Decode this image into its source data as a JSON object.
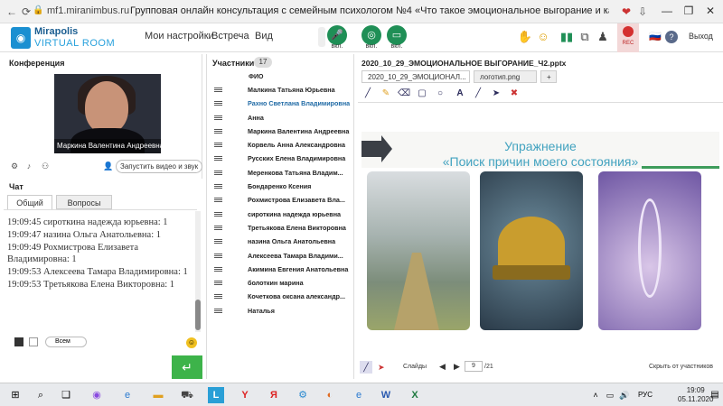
{
  "browser": {
    "url": "mf1.miranimbus.ru",
    "tab_title": "Групповая онлайн консультация с семейным психологом №4 «Что такое эмоциональное выгорание и как е...",
    "lock_icon": "lock-icon"
  },
  "header": {
    "logo_top": "Mirapolis",
    "logo_bottom": "VIRTUAL ROOM",
    "menu": [
      "Мои настройки",
      "Встреча",
      "Вид"
    ],
    "controls": [
      {
        "icon": "microphone-icon",
        "label": "вкл."
      },
      {
        "icon": "webcam-icon",
        "label": "вкл."
      },
      {
        "icon": "screen-icon",
        "label": "вкл."
      }
    ],
    "rec_label": "REC",
    "exit_label": "Выход",
    "accent": "#1f8f56"
  },
  "conference": {
    "title": "Конференция",
    "video_caption": "Маркина Валентина Андреевна",
    "video_select": "Запустить видео и звук"
  },
  "chat": {
    "title": "Чат",
    "tabs": [
      "Общий",
      "Вопросы"
    ],
    "messages": [
      "19:09:45 сироткина надежда юрьевна: 1",
      "19:09:47 назина Ольга Анатольевна: 1",
      "19:09:49 Рохмистрова Елизавета Владимировна: 1",
      "19:09:53 Алексеева Тамара Владимировна: 1",
      "19:09:53 Третьякова Елена Викторовна: 1"
    ],
    "recipient": "Всем"
  },
  "participants": {
    "title": "Участники",
    "count": "17",
    "column": "ФИО",
    "names": [
      "Малкина Татьяна Юрьевна",
      "Рахно Светлана Владимировна",
      "Анна",
      "Маркина Валентина Андреевна",
      "Корвель Анна Александровна",
      "Русских Елена Владимировна",
      "Меренкова Татьяна Владим...",
      "Бондаренко Ксения",
      "Рохмистрова Елизавета Вла...",
      "сироткина надежда юрьевна",
      "Третьякова Елена Викторовна",
      "назина Ольга Анатольевна",
      "Алексеева Тамара Владими...",
      "Акимина Евгения Анатольевна",
      "болоткин марина",
      "Кочеткова оксана александр...",
      "Наталья"
    ]
  },
  "document": {
    "title": "2020_10_29_ЭМОЦИОНАЛЬНОЕ ВЫГОРАНИЕ_Ч2.pptx",
    "tabs": [
      "2020_10_29_ЭМОЦИОНАЛ...",
      "логотип.png",
      "+"
    ],
    "slide_line1": "Упражнение",
    "slide_line2": "«Поиск причин моего состояния»",
    "slides_label": "Слайды",
    "page_current": "9",
    "page_total": "/21",
    "hide_label": "Скрыть от участников"
  },
  "taskbar": {
    "time": "19:09",
    "date": "05.11.2020",
    "lang": "РУС"
  }
}
